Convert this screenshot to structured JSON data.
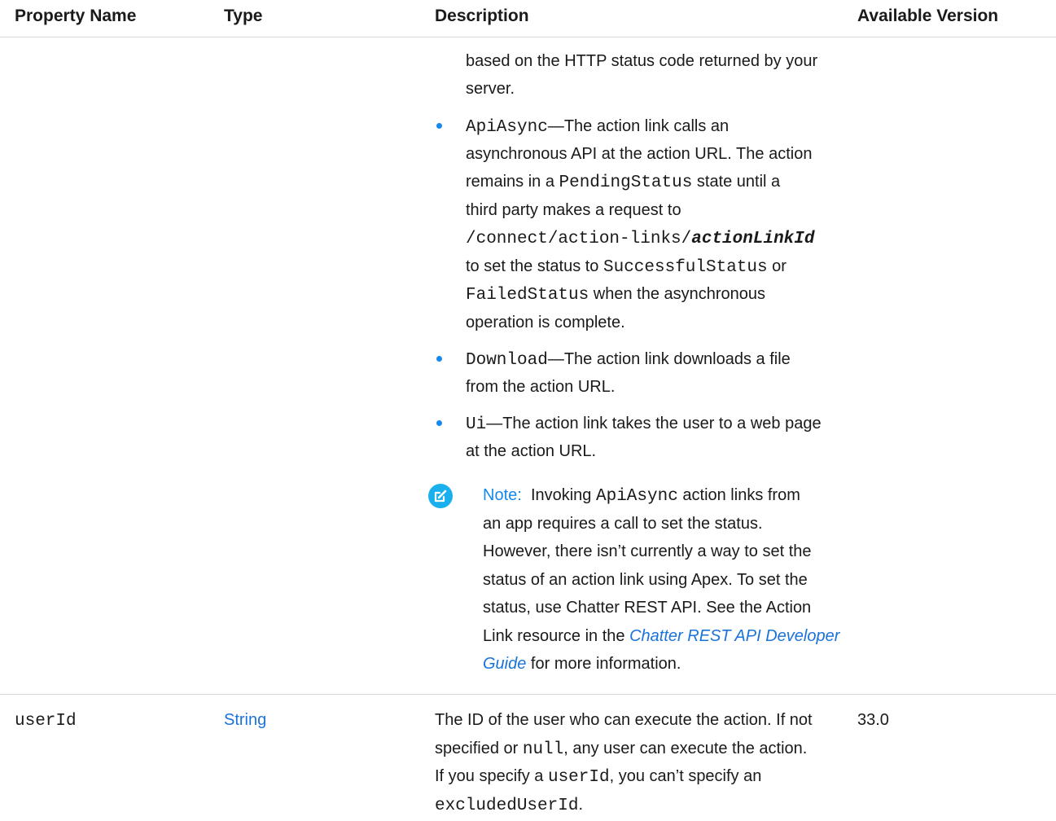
{
  "headers": {
    "property_name": "Property Name",
    "type": "Type",
    "description": "Description",
    "available_version": "Available Version"
  },
  "row1": {
    "continued": [
      "based on the HTTP status code returned by your",
      "server."
    ],
    "apiasync": {
      "code": "ApiAsync",
      "t1": "—The action link calls an",
      "l2": "asynchronous API at the action URL. The action",
      "l3a": "remains in a ",
      "l3code": "PendingStatus",
      "l3b": " state until a",
      "l4": "third party makes a request to",
      "l5code": "/connect/action-links/",
      "l5var": "actionLinkId",
      "l6a": "to set the status to ",
      "l6code": "SuccessfulStatus",
      "l6b": " or",
      "l7code": "FailedStatus",
      "l7b": " when the asynchronous",
      "l8": "operation is complete."
    },
    "download": {
      "code": "Download",
      "t1": "—The action link downloads a file",
      "l2": "from the action URL."
    },
    "ui": {
      "code": "Ui",
      "t1": "—The action link takes the user to a web page",
      "l2": "at the action URL."
    },
    "note": {
      "label": "Note:",
      "l1a": "Invoking ",
      "l1code": "ApiAsync",
      "l1b": " action links from",
      "l2": "an app requires a call to set the status.",
      "l3": "However, there isn’t currently a way to set the",
      "l4": "status of an action link using Apex. To set the",
      "l5": "status, use Chatter REST API. See the Action",
      "l6a": "Link resource in the ",
      "l6link": "Chatter REST API Developer",
      "l7link": "Guide",
      "l7b": " for more information."
    }
  },
  "row2": {
    "property": "userId",
    "type": "String",
    "version": "33.0",
    "d1": "The ID of the user who can execute the action. If not",
    "d2a": "specified or ",
    "d2code": "null",
    "d2b": ", any user can execute the action.",
    "d3a": "If you specify a ",
    "d3code": "userId",
    "d3b": ", you can’t specify an",
    "d4code": "excludedUserId",
    "d4b": "."
  },
  "colors": {
    "link": "#1a73d9",
    "bullet": "#1589ee",
    "note_icon": "#1ab0ee",
    "divider": "#d8d8d8"
  },
  "icons": {
    "note": "edit-note-icon"
  }
}
